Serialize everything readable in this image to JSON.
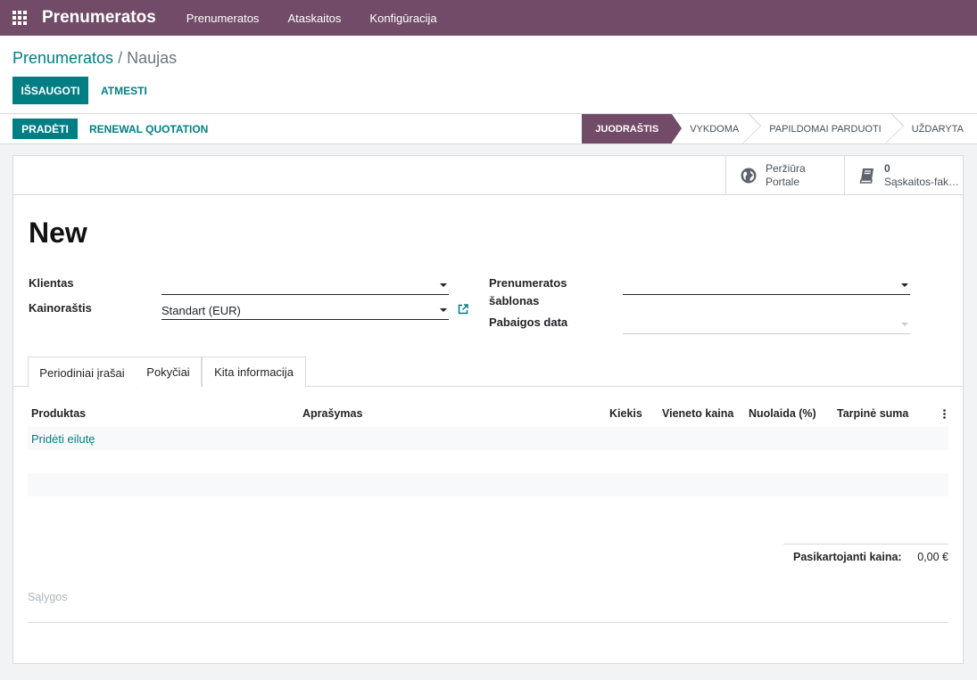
{
  "navbar": {
    "app_name": "Prenumeratos",
    "menu": [
      "Prenumeratos",
      "Ataskaitos",
      "Konfigūracija"
    ]
  },
  "breadcrumb": {
    "parent": "Prenumeratos",
    "separator": " / ",
    "current": "Naujas"
  },
  "actions": {
    "save": "Išsaugoti",
    "discard": "Atmesti"
  },
  "statusbar": {
    "start": "Pradėti",
    "renewal": "Renewal Quotation",
    "stages": [
      "Juodraštis",
      "Vykdoma",
      "Papildomai parduoti",
      "Uždaryta"
    ],
    "active_stage": "Juodraštis"
  },
  "smart_buttons": {
    "portal_line1": "Peržiūra",
    "portal_line2": "Portale",
    "invoices_count": "0",
    "invoices_label": "Sąskaitos-faktūros"
  },
  "form": {
    "title": "New",
    "client_label": "Klientas",
    "client_value": "",
    "pricelist_label": "Kainoraštis",
    "pricelist_value": "Standart (EUR)",
    "template_label_line1": "Prenumeratos",
    "template_label_line2": "šablonas",
    "template_value": "",
    "end_date_label": "Pabaigos data",
    "end_date_value": ""
  },
  "tabs": [
    "Periodiniai įrašai",
    "Pokyčiai",
    "Kita informacija"
  ],
  "table": {
    "columns": [
      "Produktas",
      "Aprašymas",
      "Kiekis",
      "Vieneto kaina",
      "Nuolaida (%)",
      "Tarpinė suma"
    ],
    "add_line": "Pridėti eilutę"
  },
  "totals": {
    "label": "Pasikartojanti kaina:",
    "value": "0,00 €"
  },
  "terms_placeholder": "Sąlygos",
  "colors": {
    "brand": "#714b67",
    "accent": "#017e84"
  }
}
